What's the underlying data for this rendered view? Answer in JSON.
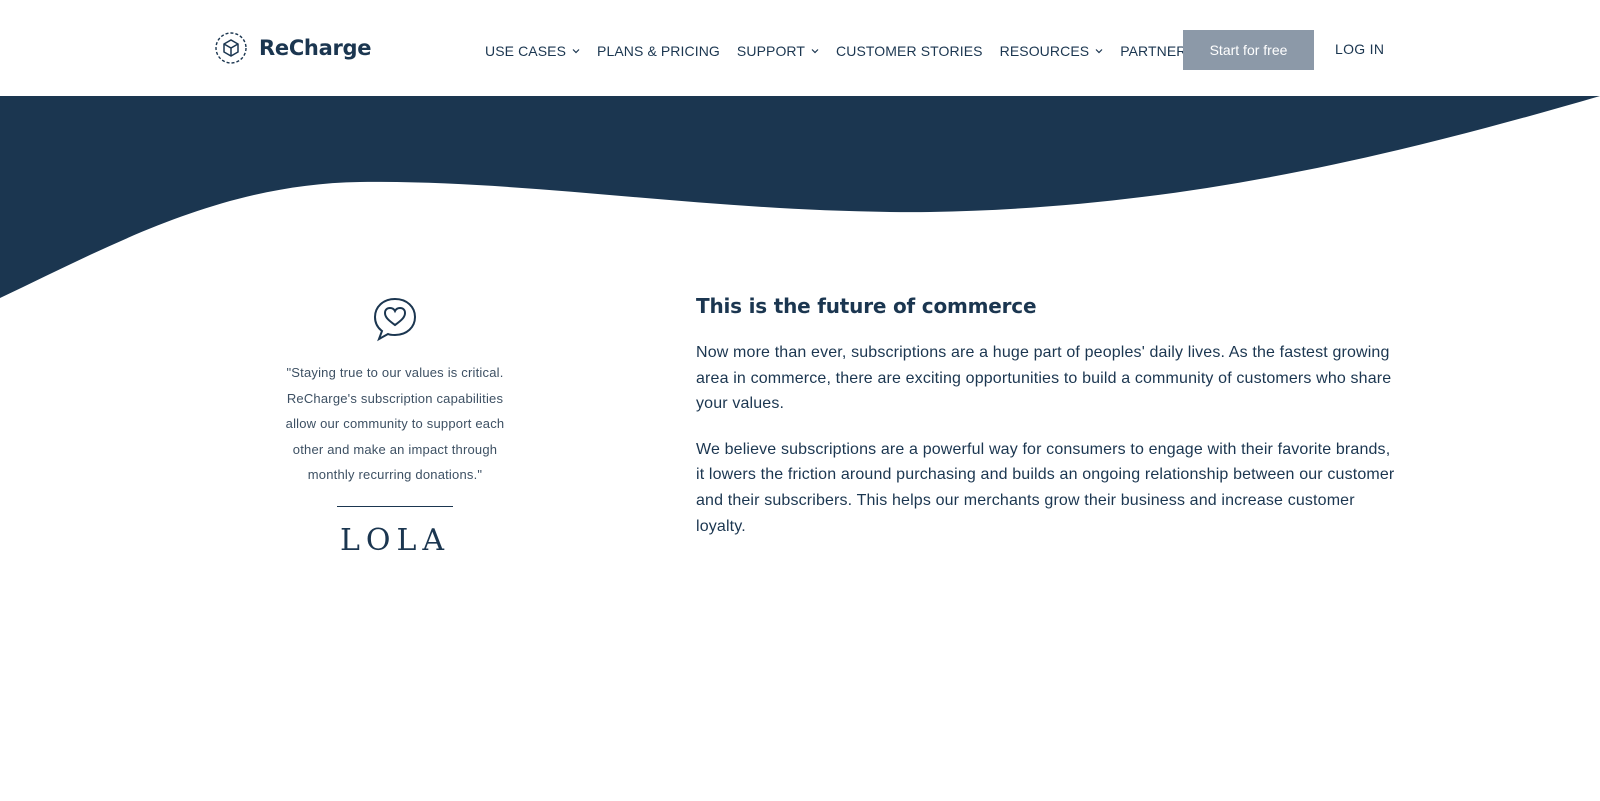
{
  "brand": {
    "name": "ReCharge"
  },
  "nav": {
    "items": [
      {
        "label": "USE CASES",
        "has_dropdown": true
      },
      {
        "label": "PLANS & PRICING",
        "has_dropdown": false
      },
      {
        "label": "SUPPORT",
        "has_dropdown": true
      },
      {
        "label": "CUSTOMER STORIES",
        "has_dropdown": false
      },
      {
        "label": "RESOURCES",
        "has_dropdown": true
      },
      {
        "label": "PARTNERS",
        "has_dropdown": true
      }
    ],
    "cta_label": "Start for free",
    "login_label": "LOG IN"
  },
  "testimonial": {
    "icon": "heart-speech-bubble-icon",
    "quote": "\"Staying true to our values is critical. ReCharge's subscription capabilities allow our community to support each other and make an impact through monthly recurring donations.\"",
    "brand": "LOLA"
  },
  "main": {
    "title": "This is the future of commerce",
    "paragraphs": [
      "Now more than ever, subscriptions are a huge part of peoples' daily lives. As the fastest growing area in commerce, there are exciting opportunities to build a community of customers who share your values.",
      "We believe subscriptions are a powerful way for consumers to engage with their favorite brands, it lowers the friction around purchasing and builds an ongoing relationship between our customer and their subscribers. This helps our merchants grow their business and increase customer loyalty."
    ]
  },
  "colors": {
    "navy": "#1b3650",
    "cta_bg": "#8c99a8",
    "background": "#ffffff"
  }
}
